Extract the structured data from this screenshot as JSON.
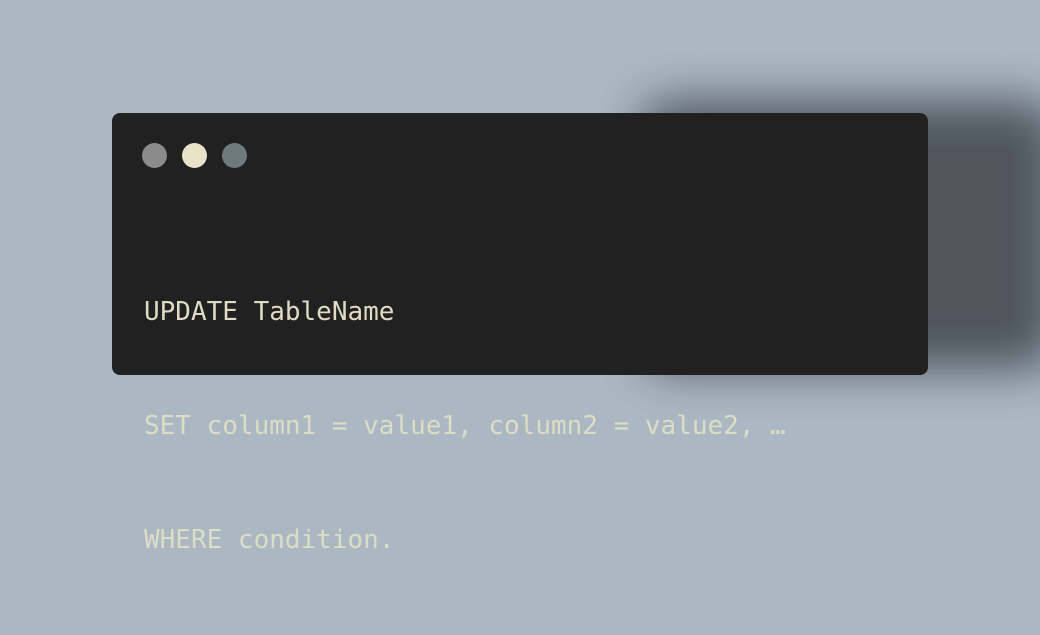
{
  "window": {
    "dots": [
      {
        "name": "gray",
        "color": "#8a8b8a"
      },
      {
        "name": "cream",
        "color": "#e8e2c9"
      },
      {
        "name": "slate",
        "color": "#6f7b7b"
      }
    ],
    "code_lines": [
      "UPDATE TableName",
      "SET column1 = value1, column2 = value2, …",
      "WHERE condition."
    ]
  },
  "colors": {
    "background": "#abb8c3",
    "window_bg": "#212121",
    "code_text": "#dddcc4"
  }
}
